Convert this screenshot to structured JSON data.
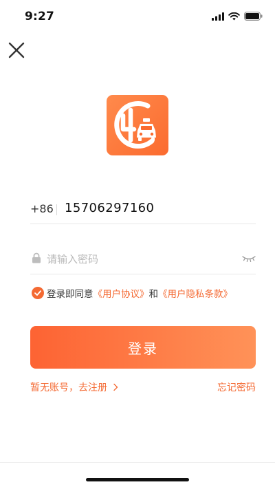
{
  "status_bar": {
    "time": "9:27",
    "icons": [
      "signal-icon",
      "wifi-icon",
      "battery-icon"
    ]
  },
  "header": {
    "close_icon": "close-icon"
  },
  "logo": {
    "icon": "app-logo-taxi-icon",
    "color": "#fb6b2f"
  },
  "form": {
    "phone": {
      "prefix": "+86",
      "value": "15706297160"
    },
    "password": {
      "placeholder": "请输入密码",
      "value": "",
      "lock_icon": "lock-icon",
      "visibility_icon": "eye-closed-icon"
    },
    "agreement": {
      "checked": true,
      "prefix": "登录即同意",
      "user_agreement": "《用户协议》",
      "and": "和",
      "privacy_policy": "《用户隐私条款》"
    },
    "login_label": "登录"
  },
  "links": {
    "register": "暂无账号，去注册",
    "forgot_password": "忘记密码"
  },
  "colors": {
    "accent": "#f46a33",
    "button_gradient_start": "#fd6333",
    "button_gradient_end": "#ff9258"
  }
}
